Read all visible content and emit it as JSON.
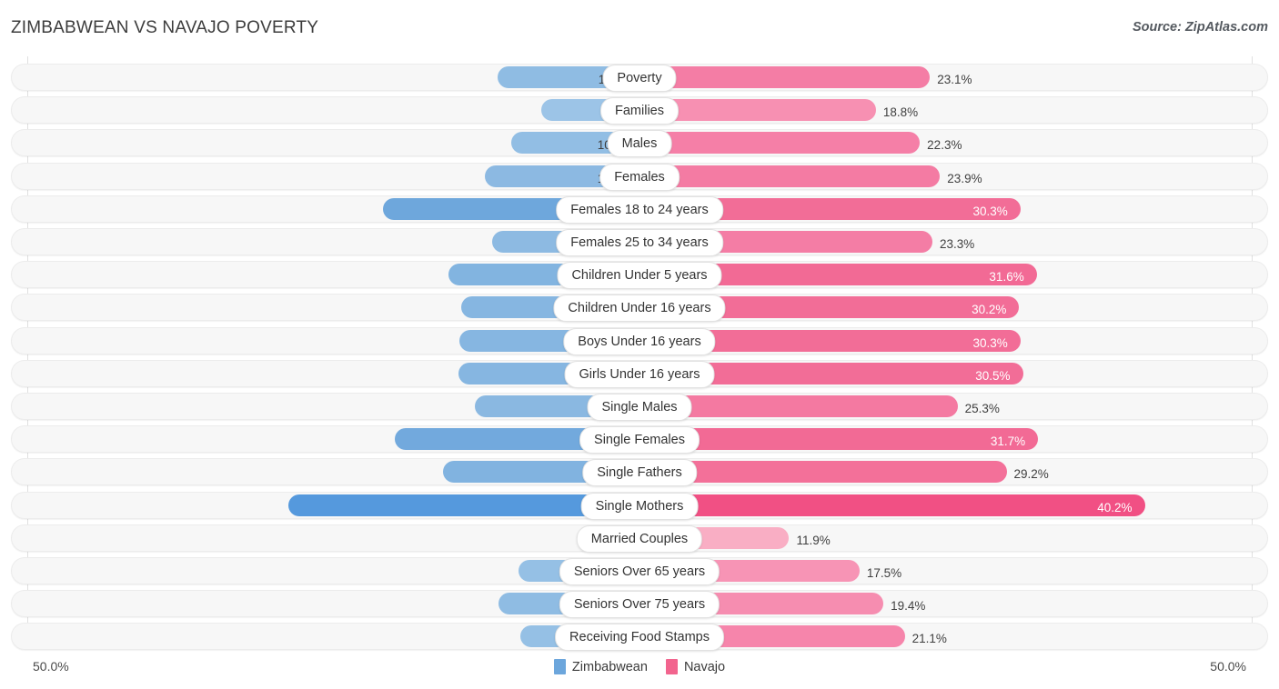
{
  "header": {
    "title": "ZIMBABWEAN VS NAVAJO POVERTY",
    "source": "Source: ZipAtlas.com"
  },
  "axis": {
    "left_label": "50.0%",
    "right_label": "50.0%",
    "max": 50.0
  },
  "legend": {
    "items": [
      {
        "label": "Zimbabwean",
        "color": "#6CA6DC"
      },
      {
        "label": "Navajo",
        "color": "#F2648E"
      }
    ]
  },
  "chart_data": {
    "type": "bar",
    "orientation": "horizontal-diverging",
    "title": "ZIMBABWEAN VS NAVAJO POVERTY",
    "xlabel": "",
    "ylabel": "",
    "xlim": [
      50.0,
      50.0
    ],
    "grid": true,
    "legend_position": "bottom-center",
    "categories": [
      "Poverty",
      "Families",
      "Males",
      "Females",
      "Females 18 to 24 years",
      "Females 25 to 34 years",
      "Children Under 5 years",
      "Children Under 16 years",
      "Boys Under 16 years",
      "Girls Under 16 years",
      "Single Males",
      "Single Females",
      "Single Fathers",
      "Single Mothers",
      "Married Couples",
      "Seniors Over 65 years",
      "Seniors Over 75 years",
      "Receiving Food Stamps"
    ],
    "series": [
      {
        "name": "Zimbabwean",
        "color": "#6CA6DC",
        "values": [
          11.3,
          7.8,
          10.2,
          12.3,
          20.4,
          11.7,
          15.2,
          14.2,
          14.3,
          14.4,
          13.1,
          19.5,
          15.6,
          27.9,
          4.1,
          9.6,
          11.2,
          9.5
        ],
        "labels": [
          "11.3%",
          "7.8%",
          "10.2%",
          "12.3%",
          "20.4%",
          "11.7%",
          "15.2%",
          "14.2%",
          "14.3%",
          "14.4%",
          "13.1%",
          "19.5%",
          "15.6%",
          "27.9%",
          "4.1%",
          "9.6%",
          "11.2%",
          "9.5%"
        ]
      },
      {
        "name": "Navajo",
        "color": "#F2648E",
        "values": [
          23.1,
          18.8,
          22.3,
          23.9,
          30.3,
          23.3,
          31.6,
          30.2,
          30.3,
          30.5,
          25.3,
          31.7,
          29.2,
          40.2,
          11.9,
          17.5,
          19.4,
          21.1
        ],
        "labels": [
          "23.1%",
          "18.8%",
          "22.3%",
          "23.9%",
          "30.3%",
          "23.3%",
          "31.6%",
          "30.2%",
          "30.3%",
          "30.5%",
          "25.3%",
          "31.7%",
          "29.2%",
          "40.2%",
          "11.9%",
          "17.5%",
          "19.4%",
          "21.1%"
        ]
      }
    ]
  },
  "rows": [
    {
      "label": "Poverty",
      "left_value": 11.3,
      "left_label": "11.3%",
      "left_color": "#8FBCE3",
      "right_value": 23.1,
      "right_label": "23.1%",
      "right_color": "#F47DA5",
      "left_inside": false,
      "right_inside": false
    },
    {
      "label": "Families",
      "left_value": 7.8,
      "left_label": "7.8%",
      "left_color": "#9CC4E7",
      "right_value": 18.8,
      "right_label": "18.8%",
      "right_color": "#F790B2",
      "left_inside": false,
      "right_inside": false
    },
    {
      "label": "Males",
      "left_value": 10.2,
      "left_label": "10.2%",
      "left_color": "#92BEE4",
      "right_value": 22.3,
      "right_label": "22.3%",
      "right_color": "#F57FA7",
      "left_inside": false,
      "right_inside": false
    },
    {
      "label": "Females",
      "left_value": 12.3,
      "left_label": "12.3%",
      "left_color": "#8CB9E2",
      "right_value": 23.9,
      "right_label": "23.9%",
      "right_color": "#F47BA3",
      "left_inside": false,
      "right_inside": false
    },
    {
      "label": "Females 18 to 24 years",
      "left_value": 20.4,
      "left_label": "20.4%",
      "left_color": "#6EA7DC",
      "right_value": 30.3,
      "right_label": "30.3%",
      "right_color": "#F26D97",
      "left_inside": false,
      "right_inside": true
    },
    {
      "label": "Females 25 to 34 years",
      "left_value": 11.7,
      "left_label": "11.7%",
      "left_color": "#8DBAE2",
      "right_value": 23.3,
      "right_label": "23.3%",
      "right_color": "#F47DA5",
      "left_inside": false,
      "right_inside": false
    },
    {
      "label": "Children Under 5 years",
      "left_value": 15.2,
      "left_label": "15.2%",
      "left_color": "#82B4E0",
      "right_value": 31.6,
      "right_label": "31.6%",
      "right_color": "#F26A95",
      "left_inside": false,
      "right_inside": true
    },
    {
      "label": "Children Under 16 years",
      "left_value": 14.2,
      "left_label": "14.2%",
      "left_color": "#86B6E1",
      "right_value": 30.2,
      "right_label": "30.2%",
      "right_color": "#F26D97",
      "left_inside": false,
      "right_inside": true
    },
    {
      "label": "Boys Under 16 years",
      "left_value": 14.3,
      "left_label": "14.3%",
      "left_color": "#86B6E1",
      "right_value": 30.3,
      "right_label": "30.3%",
      "right_color": "#F26D97",
      "left_inside": false,
      "right_inside": true
    },
    {
      "label": "Girls Under 16 years",
      "left_value": 14.4,
      "left_label": "14.4%",
      "left_color": "#86B6E1",
      "right_value": 30.5,
      "right_label": "30.5%",
      "right_color": "#F26D97",
      "left_inside": false,
      "right_inside": true
    },
    {
      "label": "Single Males",
      "left_value": 13.1,
      "left_label": "13.1%",
      "left_color": "#8AB8E1",
      "right_value": 25.3,
      "right_label": "25.3%",
      "right_color": "#F479A1",
      "left_inside": false,
      "right_inside": false
    },
    {
      "label": "Single Females",
      "left_value": 19.5,
      "left_label": "19.5%",
      "left_color": "#72A9DD",
      "right_value": 31.7,
      "right_label": "31.7%",
      "right_color": "#F26A95",
      "left_inside": false,
      "right_inside": true
    },
    {
      "label": "Single Fathers",
      "left_value": 15.6,
      "left_label": "15.6%",
      "left_color": "#81B3E0",
      "right_value": 29.2,
      "right_label": "29.2%",
      "right_color": "#F37099",
      "left_inside": false,
      "right_inside": false
    },
    {
      "label": "Single Mothers",
      "left_value": 27.9,
      "left_label": "27.9%",
      "left_color": "#5599DD",
      "right_value": 40.2,
      "right_label": "40.2%",
      "right_color": "#F15084",
      "left_inside": false,
      "right_inside": true
    },
    {
      "label": "Married Couples",
      "left_value": 4.1,
      "left_label": "4.1%",
      "left_color": "#A8C9EC",
      "right_value": 11.9,
      "right_label": "11.9%",
      "right_color": "#F9AEC4",
      "left_inside": false,
      "right_inside": false
    },
    {
      "label": "Seniors Over 65 years",
      "left_value": 9.6,
      "left_label": "9.6%",
      "left_color": "#95C0E5",
      "right_value": 17.5,
      "right_label": "17.5%",
      "right_color": "#F794B5",
      "left_inside": false,
      "right_inside": false
    },
    {
      "label": "Seniors Over 75 years",
      "left_value": 11.2,
      "left_label": "11.2%",
      "left_color": "#8FBCE3",
      "right_value": 19.4,
      "right_label": "19.4%",
      "right_color": "#F68DB0",
      "left_inside": false,
      "right_inside": false
    },
    {
      "label": "Receiving Food Stamps",
      "left_value": 9.5,
      "left_label": "9.5%",
      "left_color": "#95C0E5",
      "right_value": 21.1,
      "right_label": "21.1%",
      "right_color": "#F685AB",
      "left_inside": false,
      "right_inside": false
    }
  ]
}
